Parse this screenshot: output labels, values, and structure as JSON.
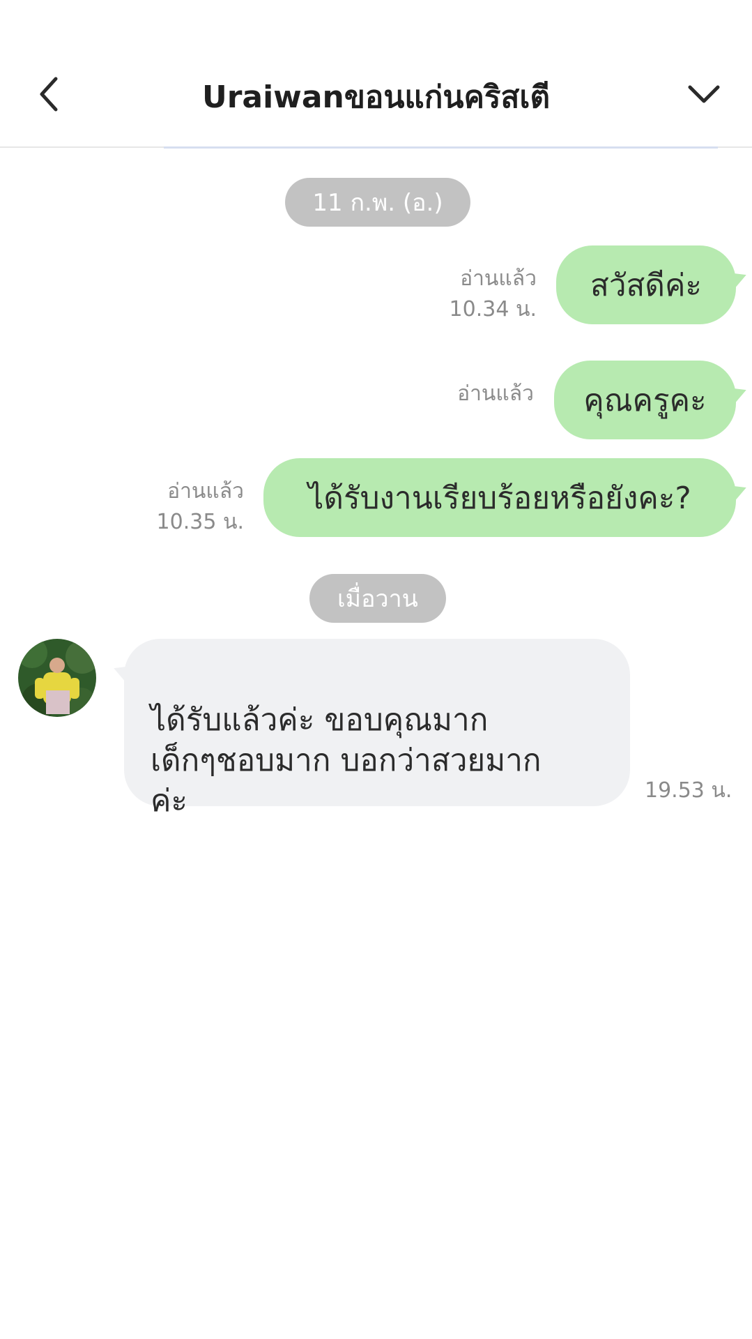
{
  "header": {
    "title": "Uraiwanขอนแก่นคริสเตี",
    "back_icon": "chevron-left-icon",
    "menu_icon": "chevron-down-icon"
  },
  "divider_dates": {
    "first": "11 ก.พ. (อ.)",
    "second": "เมื่อวาน"
  },
  "messages": [
    {
      "direction": "out",
      "text": "สวัสดีค่ะ",
      "read_label": "อ่านแล้ว",
      "time": "10.34 น."
    },
    {
      "direction": "out",
      "text": "คุณครูคะ",
      "read_label": "อ่านแล้ว",
      "time": ""
    },
    {
      "direction": "out",
      "text": "ได้รับงานเรียบร้อยหรือยังคะ?",
      "read_label": "อ่านแล้ว",
      "time": "10.35 น."
    },
    {
      "direction": "in",
      "text": "ได้รับแล้วค่ะ  ขอบคุณมาก\n เด็กๆชอบมาก  บอกว่าสวยมาก\nค่ะ",
      "time": "19.53 น."
    }
  ],
  "colors": {
    "outgoing_bubble": "#b7eab0",
    "incoming_bubble": "#f0f1f3",
    "date_chip": "#c2c2c2",
    "meta_text": "#8a8a8a"
  }
}
